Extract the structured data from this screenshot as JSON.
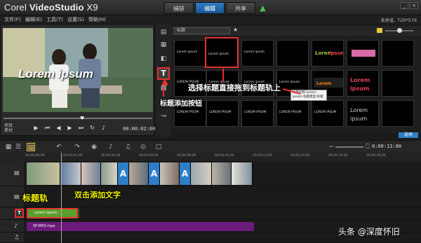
{
  "app": {
    "title": "Corel VideoStudio X9",
    "brand_prefix": "Corel",
    "brand_name": "VideoStudio",
    "brand_version": "X9"
  },
  "tabs": [
    {
      "label": "捕获",
      "active": false
    },
    {
      "label": "编辑",
      "active": true
    },
    {
      "label": "共享",
      "active": false
    }
  ],
  "menu": [
    "文件(F)",
    "编辑(E)",
    "工具(T)",
    "设置(S)",
    "帮助(H)"
  ],
  "project_info": "未命名, 720*576",
  "player": {
    "overlay_text": "Lorem ipsum",
    "mode_labels": [
      "项目",
      "素材"
    ],
    "timecode": "00:00:02:00"
  },
  "library": {
    "category": "标题",
    "thumbs": [
      "Lorem ipsum",
      "Lorem ipsum",
      "Lorem ipsum",
      "",
      "",
      "",
      "LOREM IPSUM",
      "Lorem ipsum",
      "Lorem ipsum",
      "Lorem ipsum",
      "Lorem ipsum",
      "Lorem ipsum",
      "LOREM IPSUM",
      "LOREM IPSUM",
      "LOREM IPSUM",
      "LOREM IPSUM",
      "LOREM IPSUM",
      "Lorem ipsum"
    ],
    "tooltip": "标题名称:Lorem ipsum 标题类型:标题",
    "options_label": "选项"
  },
  "annotations": {
    "drag_title": "选择标题直接拖到标题轨上",
    "title_button": "标题添加按钮",
    "title_track": "标题轨",
    "dbl_click": "双击添加文字"
  },
  "timeline": {
    "time": "0:00:13:00",
    "ruler": [
      "00:00:00:00",
      "00:00:02:00",
      "00:00:04:00",
      "00:00:06:00",
      "00:00:08:00",
      "00:00:10:00",
      "00:00:12:00",
      "00:00:14:00",
      "00:00:16:00",
      "00:00:18:00",
      "00:00:20:00",
      "00:00:22:00",
      "00:00:24:00"
    ],
    "title_clip": "Lorem ipsum",
    "audio_clip": "SP-M03.mpa",
    "transition_letter": "A"
  },
  "watermark": "头条 @深度怀旧",
  "colors": {
    "accent_blue": "#2f7fc7",
    "highlight_red": "#e53030",
    "annotation_yellow": "#f3f300",
    "title_clip_green": "#5c9e2b",
    "audio_clip_purple": "#6b1a7a"
  }
}
